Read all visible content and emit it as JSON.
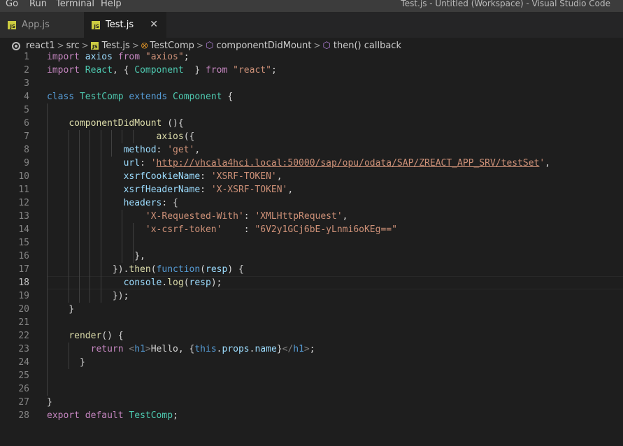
{
  "menubar": {
    "items": [
      "Go",
      "Run",
      "Terminal",
      "Help"
    ],
    "window_title": "Test.js - Untitled (Workspace) - Visual Studio Code"
  },
  "tabs": [
    {
      "label": "App.js",
      "icon": "js-file-icon",
      "active": false
    },
    {
      "label": "Test.js",
      "icon": "js-file-icon",
      "active": true
    }
  ],
  "tab_close_glyph": "✕",
  "breadcrumb": {
    "items": [
      "react1",
      "src",
      "Test.js",
      "TestComp",
      "componentDidMount",
      "then() callback"
    ]
  },
  "editor": {
    "current_line": 18,
    "line_numbers": [
      "1",
      "2",
      "3",
      "4",
      "5",
      "6",
      "7",
      "8",
      "9",
      "10",
      "11",
      "12",
      "13",
      "14",
      "15",
      "16",
      "17",
      "18",
      "19",
      "20",
      "21",
      "22",
      "23",
      "24",
      "25",
      "26",
      "27",
      "28"
    ],
    "lines": [
      "import axios from \"axios\";",
      "import React, { Component  } from \"react\";",
      "",
      "class TestComp extends Component {",
      "",
      "    componentDidMount (){",
      "                    axios({",
      "              method: 'get',",
      "              url: 'http://vhcala4hci.local:50000/sap/opu/odata/SAP/ZREACT_APP_SRV/testSet',",
      "              xsrfCookieName: 'XSRF-TOKEN',",
      "              xsrfHeaderName: 'X-XSRF-TOKEN',",
      "              headers: {",
      "                  'X-Requested-With': 'XMLHttpRequest',",
      "                  'x-csrf-token'    : \"6V2y1GCj6bE-yLnmi6oKEg==\"",
      "",
      "                },",
      "            }).then(function(resp) {",
      "              console.log(resp);",
      "            });",
      "    }",
      "",
      "    render() {",
      "        return <h1>Hello, {this.props.name}</h1>;",
      "      }",
      "",
      "",
      "}",
      "export default TestComp;"
    ]
  },
  "colors": {
    "background": "#1e1e1e",
    "keyword": "#569cd6",
    "control_keyword": "#c586c0",
    "class_name": "#4ec9b0",
    "function": "#dcdcaa",
    "variable": "#9cdcfe",
    "string": "#ce9178",
    "js_icon": "#cbcb41"
  }
}
